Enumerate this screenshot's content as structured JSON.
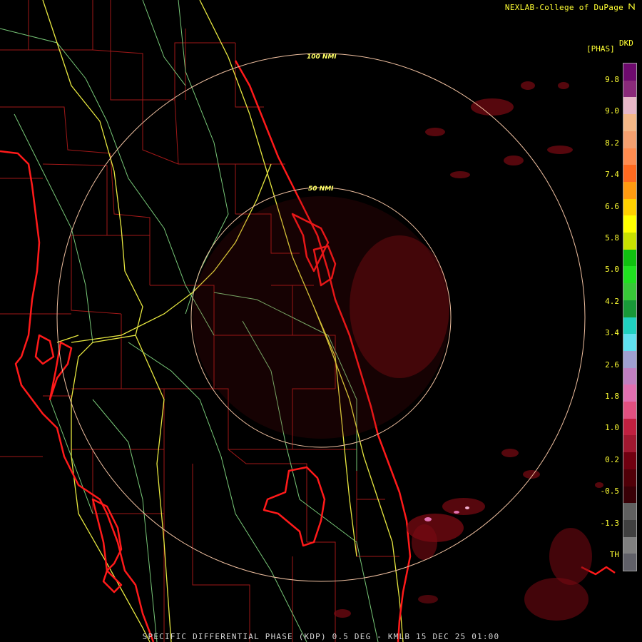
{
  "credit": "NEXLAB-College of DuPage",
  "credit_icon": "nexlab-logo-icon",
  "footer": "SPECIFIC DIFFERENTIAL PHASE (KDP) 0.5 DEG - KMLB 15 DEC 25 01:00",
  "legend": {
    "unit": "[PHAS]",
    "code": "DKD",
    "ticks": [
      "9.8",
      "9.0",
      "8.2",
      "7.4",
      "6.6",
      "5.8",
      "5.0",
      "4.2",
      "3.4",
      "2.6",
      "1.8",
      "1.0",
      "0.2",
      "-0.5",
      "-1.3",
      "TH"
    ],
    "colors": [
      "#6e0a6e",
      "#8a2a7a",
      "#e8b8c8",
      "#f5b888",
      "#f5a070",
      "#ff8c50",
      "#ff6a20",
      "#ff9a10",
      "#ffd000",
      "#ffff00",
      "#c8e000",
      "#10c010",
      "#20e020",
      "#38c838",
      "#189838",
      "#20d0c0",
      "#60e0f0",
      "#a0a0d0",
      "#c080c0",
      "#e070b0",
      "#e05080",
      "#c02040",
      "#a01830",
      "#700010",
      "#500008",
      "#380006",
      "#606060",
      "#404040",
      "#808080",
      "#606068"
    ]
  },
  "range_rings": [
    "100 NMI",
    "50 NMI"
  ],
  "colors": {
    "coast": "#ff1a1a",
    "county": "#a01818",
    "highway": "#e8e840",
    "road": "#78c878",
    "ring": "#f0c0a0",
    "echo": "#7a0a12"
  }
}
